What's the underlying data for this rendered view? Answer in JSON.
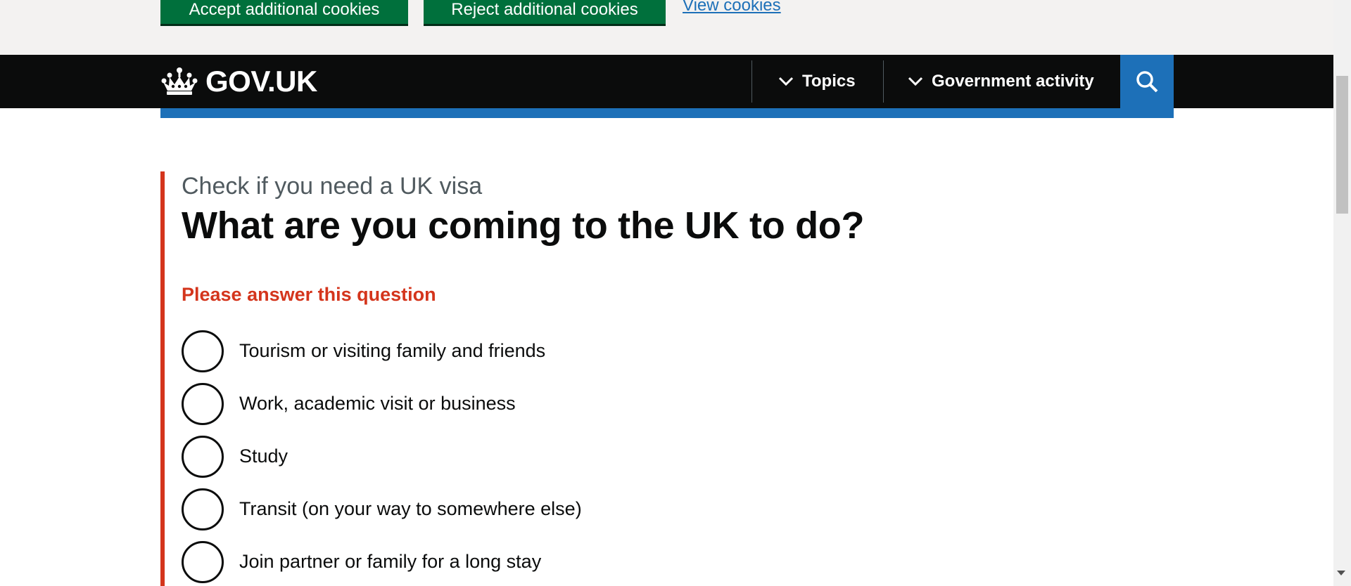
{
  "cookie_banner": {
    "accept_label": "Accept additional cookies",
    "reject_label": "Reject additional cookies",
    "view_link": "View cookies"
  },
  "header": {
    "logo_text": "GOV.UK",
    "logo_icon": "crown-icon",
    "nav": [
      {
        "label": "Topics",
        "icon": "chevron-down-icon"
      },
      {
        "label": "Government activity",
        "icon": "chevron-down-icon"
      }
    ],
    "search_icon": "search-icon"
  },
  "main": {
    "caption": "Check if you need a UK visa",
    "heading": "What are you coming to the UK to do?",
    "error_message": "Please answer this question",
    "options": [
      "Tourism or visiting family and friends",
      "Work, academic visit or business",
      "Study",
      "Transit (on your way to somewhere else)",
      "Join partner or family for a long stay"
    ]
  },
  "colors": {
    "button_green": "#00703c",
    "link_blue": "#1d70b8",
    "header_black": "#0b0c0c",
    "error_red": "#d4351c",
    "secondary_text": "#505a5f"
  }
}
